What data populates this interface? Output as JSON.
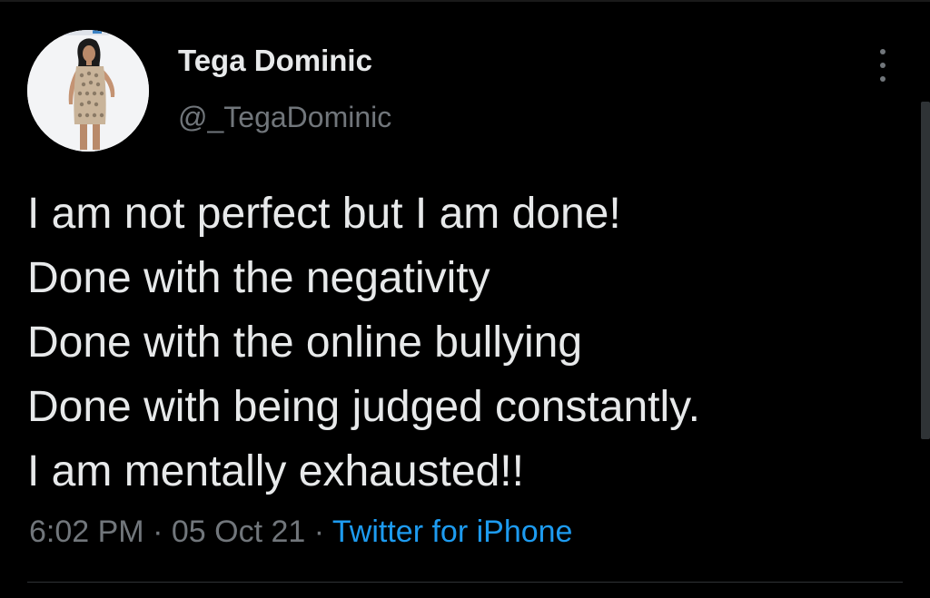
{
  "user": {
    "display_name": "Tega Dominic",
    "handle": "@_TegaDominic"
  },
  "tweet": {
    "lines": [
      "I am not perfect but I am done!",
      "Done with the negativity",
      "Done with the online bullying",
      "Done with being judged constantly.",
      "I am mentally exhausted!!"
    ],
    "time": "6:02 PM",
    "separator": "·",
    "date": "05 Oct 21",
    "source": "Twitter for iPhone"
  },
  "icons": {
    "more": "more-options-icon",
    "avatar": "avatar-photo"
  },
  "colors": {
    "background": "#000000",
    "text": "#e7e9ea",
    "muted": "#71767b",
    "link": "#1d9bf0"
  }
}
